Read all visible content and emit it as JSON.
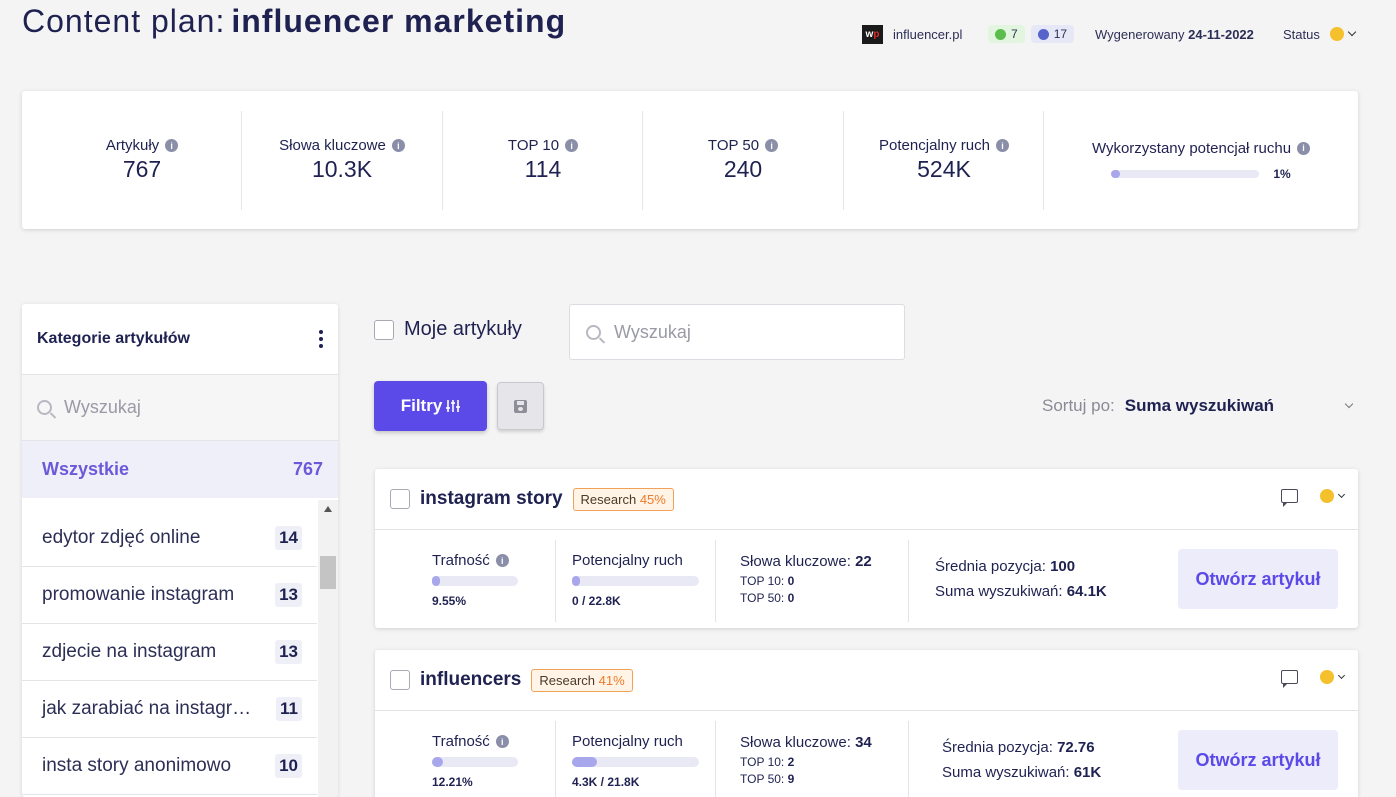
{
  "header": {
    "title_label": "Content plan:",
    "title_value": "influencer marketing",
    "site_logo_text": "wp",
    "site": "influencer.pl",
    "green_badge": "7",
    "blue_badge": "17",
    "generated_label": "Wygenerowany",
    "generated_date": "24-11-2022",
    "status_label": "Status"
  },
  "stats": {
    "articles_label": "Artykuły",
    "articles_value": "767",
    "keywords_label": "Słowa kluczowe",
    "keywords_value": "10.3K",
    "top10_label": "TOP 10",
    "top10_value": "114",
    "top50_label": "TOP 50",
    "top50_value": "240",
    "traffic_label": "Potencjalny ruch",
    "traffic_value": "524K",
    "used_label": "Wykorzystany potencjał ruchu",
    "used_value": "1%",
    "used_fraction": 0.01
  },
  "sidebar": {
    "title": "Kategorie artykułów",
    "search_placeholder": "Wyszukaj",
    "all_label": "Wszystkie",
    "all_count": "767",
    "items": [
      {
        "label": "edytor zdjęć online",
        "count": "14"
      },
      {
        "label": "promowanie instagram",
        "count": "13"
      },
      {
        "label": "zdjecie na instagram",
        "count": "13"
      },
      {
        "label": "jak zarabiać na instagr…",
        "count": "11"
      },
      {
        "label": "insta story anonimowo",
        "count": "10"
      }
    ]
  },
  "toolbar": {
    "my_articles": "Moje artykuły",
    "search_placeholder": "Wyszukaj",
    "filters": "Filtry",
    "sort_label": "Sortuj po:",
    "sort_value": "Suma wyszukiwań"
  },
  "articles": [
    {
      "name": "instagram story",
      "badge_label": "Research",
      "badge_pct": "45%",
      "relevance_label": "Trafność",
      "relevance_value": "9.55%",
      "relevance_fraction": 0.0955,
      "traffic_label": "Potencjalny ruch",
      "traffic_value": "0 / 22.8K",
      "traffic_fraction": 0,
      "keywords_label": "Słowa kluczowe:",
      "keywords_value": "22",
      "top10_label": "TOP 10:",
      "top10_value": "0",
      "top50_label": "TOP 50:",
      "top50_value": "0",
      "avg_label": "Średnia pozycja:",
      "avg_value": "100",
      "sum_label": "Suma wyszukiwań:",
      "sum_value": "64.1K",
      "open_label": "Otwórz artykuł"
    },
    {
      "name": "influencers",
      "badge_label": "Research",
      "badge_pct": "41%",
      "relevance_label": "Trafność",
      "relevance_value": "12.21%",
      "relevance_fraction": 0.1221,
      "traffic_label": "Potencjalny ruch",
      "traffic_value": "4.3K / 21.8K",
      "traffic_fraction": 0.197,
      "keywords_label": "Słowa kluczowe:",
      "keywords_value": "34",
      "top10_label": "TOP 10:",
      "top10_value": "2",
      "top50_label": "TOP 50:",
      "top50_value": "9",
      "avg_label": "Średnia pozycja:",
      "avg_value": "72.76",
      "sum_label": "Suma wyszukiwań:",
      "sum_value": "61K",
      "open_label": "Otwórz artykuł"
    }
  ],
  "colors": {
    "accent": "#5b49e8",
    "status": "#f4c02c",
    "research": "#ef7a2a"
  }
}
